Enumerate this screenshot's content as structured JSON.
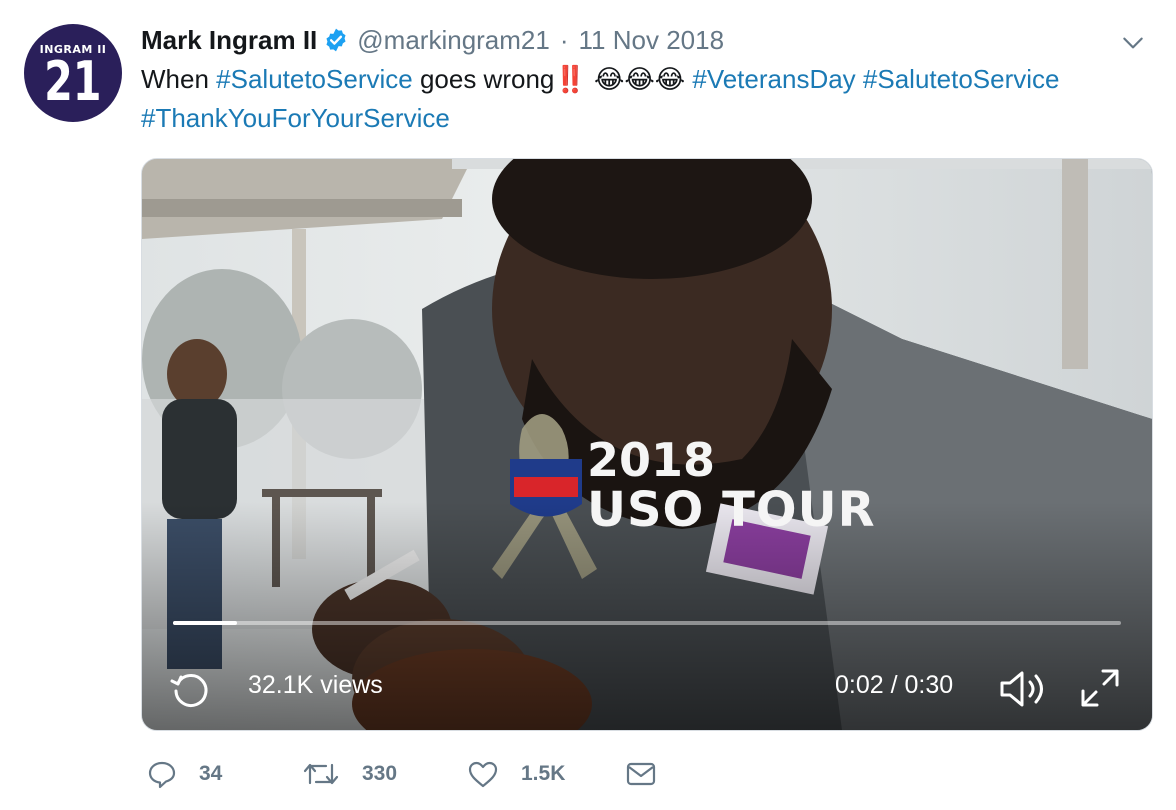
{
  "tweet": {
    "avatar": {
      "name_text": "INGRAM II",
      "number_text": "21"
    },
    "author_name": "Mark Ingram II",
    "handle": "@markingram21",
    "separator": "·",
    "date": "11 Nov 2018",
    "text_parts": {
      "p1": "When ",
      "tag1": "#SalutetoService",
      "p2": " goes wrong",
      "bangs": "‼️",
      "emojis": "😂😂😂",
      "tag2": "#VeteransDay",
      "tag3": "#SalutetoService",
      "tag4": "#ThankYouForYourService"
    },
    "video": {
      "overlay_year": "2018",
      "overlay_title": "USO TOUR",
      "views": "32.1K views",
      "time": "0:02 / 0:30",
      "progress": 0.068
    },
    "actions": {
      "replies": "34",
      "retweets": "330",
      "likes": "1.5K"
    }
  }
}
